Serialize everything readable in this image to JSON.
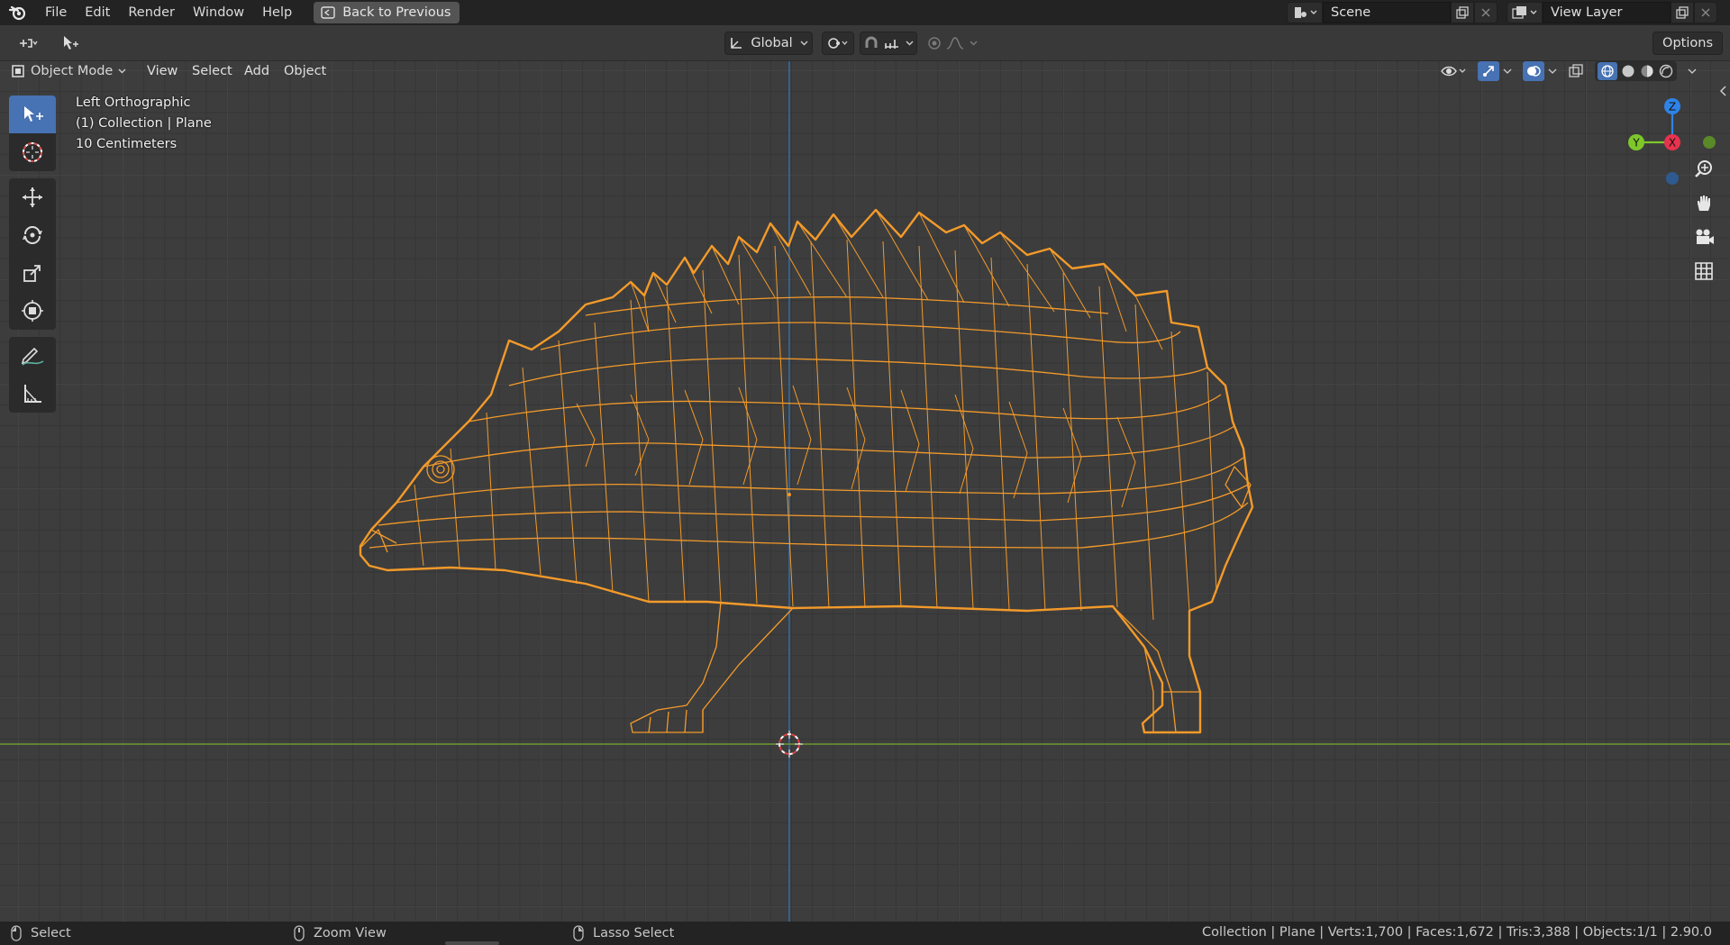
{
  "menubar": {
    "items": [
      "File",
      "Edit",
      "Render",
      "Window",
      "Help"
    ],
    "back_button": "Back to Previous",
    "scene": "Scene",
    "view_layer": "View Layer"
  },
  "tool_header": {
    "orientation": "Global",
    "options": "Options"
  },
  "viewport_header": {
    "mode": "Object Mode",
    "menus": [
      "View",
      "Select",
      "Add",
      "Object"
    ]
  },
  "viewport_overlay": {
    "view_name": "Left Orthographic",
    "collection_info": "(1) Collection | Plane",
    "scale": "10 Centimeters"
  },
  "gizmo": {
    "z": "Z",
    "y": "Y",
    "x": "X"
  },
  "statusbar": {
    "left_action": "Select",
    "mid_action": "Zoom View",
    "right_action": "Lasso Select",
    "stats": "Collection | Plane | Verts:1,700 | Faces:1,672 | Tris:3,388 | Objects:1/1 | 2.90.0"
  },
  "colors": {
    "accent": "#4772b3",
    "wire": "#f39a2a",
    "axis_y": "#6e9a30",
    "axis_z": "#2f6fb0"
  }
}
